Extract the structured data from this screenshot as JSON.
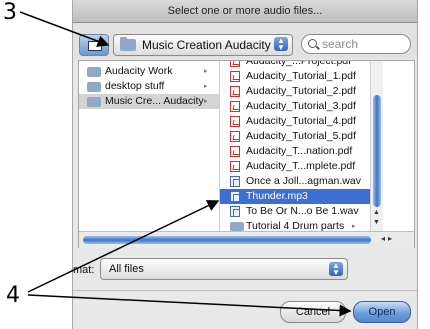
{
  "callouts": {
    "number_top": "3",
    "number_bottom": "4"
  },
  "dialog": {
    "title": "Select one or more audio files...",
    "current_folder": "Music Creation Audacity",
    "search_placeholder": "search"
  },
  "sidebar": {
    "items": [
      {
        "label": "Audacity Work",
        "arrow": "▸",
        "selected": false
      },
      {
        "label": "desktop stuff",
        "arrow": "▸",
        "selected": false
      },
      {
        "label": "Music Cre... Audacity",
        "arrow": "▸",
        "selected": true
      }
    ]
  },
  "files": {
    "items": [
      {
        "label": "Audacity_...Project.pdf",
        "icon": "pdf-icon",
        "selected": false
      },
      {
        "label": "Audacity_Tutorial_1.pdf",
        "icon": "pdf-icon",
        "selected": false
      },
      {
        "label": "Audacity_Tutorial_2.pdf",
        "icon": "pdf-icon",
        "selected": false
      },
      {
        "label": "Audacity_Tutorial_3.pdf",
        "icon": "pdf-icon",
        "selected": false
      },
      {
        "label": "Audacity_Tutorial_4.pdf",
        "icon": "pdf-icon",
        "selected": false
      },
      {
        "label": "Audacity_Tutorial_5.pdf",
        "icon": "pdf-icon",
        "selected": false
      },
      {
        "label": "Audacity_T...nation.pdf",
        "icon": "pdf-icon",
        "selected": false
      },
      {
        "label": "Audacity_T...mplete.pdf",
        "icon": "pdf-icon",
        "selected": false
      },
      {
        "label": "Once a Joll...agman.wav",
        "icon": "audio-file-icon",
        "selected": false
      },
      {
        "label": "Thunder.mp3",
        "icon": "audio-file-icon",
        "selected": true
      },
      {
        "label": "To Be Or N...o Be 1.wav",
        "icon": "audio-file-icon",
        "selected": false
      },
      {
        "label": "Tutorial 4 Drum parts",
        "icon": "folder-icon",
        "arrow": "▸",
        "selected": false
      }
    ]
  },
  "format": {
    "label": "mat:",
    "value": "All files"
  },
  "buttons": {
    "cancel": "Cancel",
    "open": "Open"
  },
  "colors": {
    "selection": "#3c6fd0",
    "accent": "#4f87d0"
  }
}
